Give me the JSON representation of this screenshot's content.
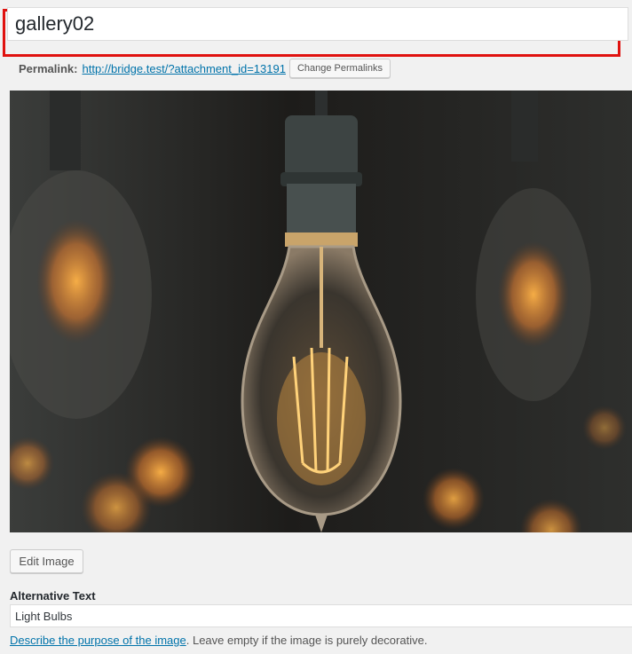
{
  "title_field": {
    "value": "gallery02"
  },
  "permalink": {
    "label": "Permalink:",
    "url": "http://bridge.test/?attachment_id=13191",
    "change_button": "Change Permalinks"
  },
  "image": {
    "subject": "light-bulbs-photo"
  },
  "edit_button": "Edit Image",
  "alt_text": {
    "label": "Alternative Text",
    "value": "Light Bulbs",
    "help_link": "Describe the purpose of the image",
    "help_rest": ". Leave empty if the image is purely decorative."
  },
  "colors": {
    "highlight": "#e0120f",
    "link": "#0073aa"
  }
}
